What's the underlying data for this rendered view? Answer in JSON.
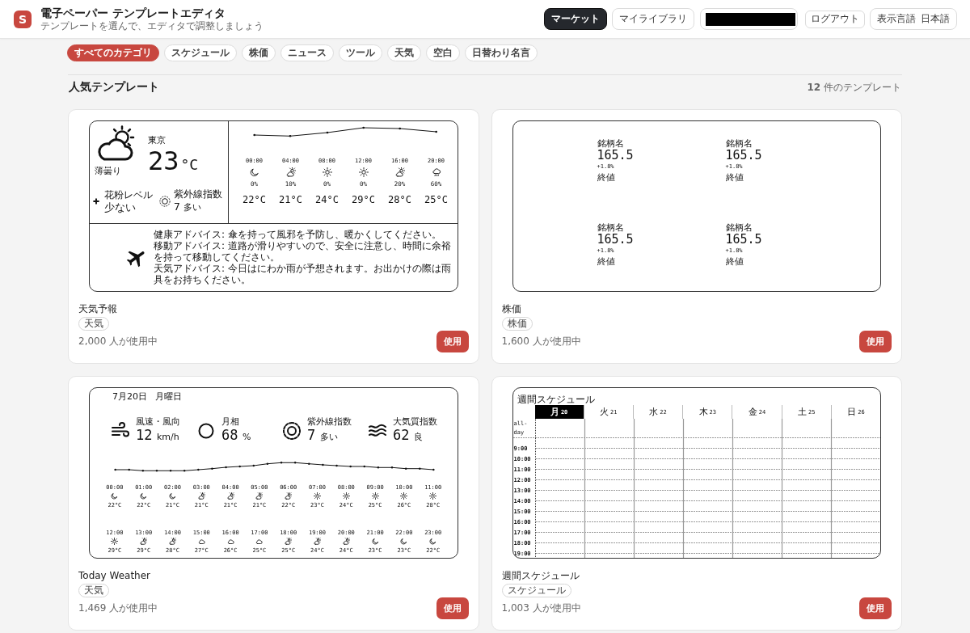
{
  "header": {
    "logo": "S",
    "title": "電子ペーパー テンプレートエディタ",
    "subtitle": "テンプレートを選んで、エディタで調整しましょう",
    "nav": [
      {
        "label": "マーケット",
        "selected": true
      },
      {
        "label": "マイライブラリ",
        "selected": false
      }
    ],
    "logout": "ログアウト",
    "language": {
      "label": "表示言語",
      "value": "日本語"
    }
  },
  "categories": [
    {
      "label": "すべてのカテゴリ",
      "selected": true
    },
    {
      "label": "スケジュール",
      "selected": false
    },
    {
      "label": "株価",
      "selected": false
    },
    {
      "label": "ニュース",
      "selected": false
    },
    {
      "label": "ツール",
      "selected": false
    },
    {
      "label": "天気",
      "selected": false
    },
    {
      "label": "空白",
      "selected": false
    },
    {
      "label": "日替わり名言",
      "selected": false
    }
  ],
  "section": {
    "title": "人気テンプレート",
    "count": "**12** 件のテンプレート"
  },
  "templates": [
    {
      "kind": "weather_forecast",
      "name": "天気予報",
      "tag": "天気",
      "usage": "2,000 人が使用中",
      "action": "使用",
      "preview": {
        "city": "東京",
        "temperature": "23",
        "unit": "°C",
        "condition": "薄曇り",
        "pollen": {
          "label": "花粉レベル",
          "value": "少ない"
        },
        "uv": {
          "label": "紫外線指数",
          "value": "7",
          "note": "多い"
        },
        "hours": [
          {
            "time": "00:00",
            "kind": "moon",
            "precip": "0%",
            "temp": "22°C"
          },
          {
            "time": "04:00",
            "kind": "cloud_sun",
            "precip": "10%",
            "temp": "21°C"
          },
          {
            "time": "08:00",
            "kind": "sun",
            "precip": "0%",
            "temp": "24°C"
          },
          {
            "time": "12:00",
            "kind": "sun",
            "precip": "0%",
            "temp": "29°C"
          },
          {
            "time": "16:00",
            "kind": "cloud_sun",
            "precip": "20%",
            "temp": "28°C"
          },
          {
            "time": "20:00",
            "kind": "rain",
            "precip": "60%",
            "temp": "25°C"
          }
        ],
        "advice": [
          "健康アドバイス: 傘を持って風邪を予防し、暖かくしてください。",
          "移動アドバイス: 道路が滑りやすいので、安全に注意し、時間に余裕を持って移動してください。",
          "天気アドバイス: 今日はにわか雨が予想されます。お出かけの際は雨具をお持ちください。"
        ]
      }
    },
    {
      "kind": "stocks",
      "name": "株価",
      "tag": "株価",
      "usage": "1,600 人が使用中",
      "action": "使用",
      "preview": {
        "stocks": [
          {
            "name": "銘柄名",
            "price": "165.5",
            "change": "+1.8%",
            "note": "終値"
          },
          {
            "name": "銘柄名",
            "price": "165.5",
            "change": "+1.8%",
            "note": "終値"
          },
          {
            "name": "銘柄名",
            "price": "165.5",
            "change": "+1.8%",
            "note": "終値"
          },
          {
            "name": "銘柄名",
            "price": "165.5",
            "change": "+1.8%",
            "note": "終値"
          }
        ]
      }
    },
    {
      "kind": "today_weather",
      "name": "Today Weather",
      "tag": "天気",
      "usage": "1,469 人が使用中",
      "action": "使用",
      "preview": {
        "date": "7月20日",
        "weekday": "月曜日",
        "metrics": [
          {
            "kind": "wind",
            "label": "風速・風向",
            "value": "12",
            "unit": "km/h"
          },
          {
            "kind": "moon_phase",
            "label": "月相",
            "value": "68",
            "unit": "%"
          },
          {
            "kind": "uv",
            "label": "紫外線指数",
            "value": "7",
            "unit": "多い"
          },
          {
            "kind": "air",
            "label": "大気質指数",
            "value": "62",
            "unit": "良"
          }
        ],
        "hour_rows": [
          [
            {
              "time": "00:00",
              "kind": "moon",
              "temp": "22°C"
            },
            {
              "time": "01:00",
              "kind": "moon",
              "temp": "22°C"
            },
            {
              "time": "02:00",
              "kind": "moon",
              "temp": "21°C"
            },
            {
              "time": "03:00",
              "kind": "cloud_sun",
              "temp": "21°C"
            },
            {
              "time": "04:00",
              "kind": "cloud_sun",
              "temp": "21°C"
            },
            {
              "time": "05:00",
              "kind": "cloud_sun",
              "temp": "21°C"
            },
            {
              "time": "06:00",
              "kind": "cloud_sun",
              "temp": "22°C"
            },
            {
              "time": "07:00",
              "kind": "sun",
              "temp": "23°C"
            },
            {
              "time": "08:00",
              "kind": "sun",
              "temp": "24°C"
            },
            {
              "time": "09:00",
              "kind": "sun",
              "temp": "25°C"
            },
            {
              "time": "10:00",
              "kind": "sun",
              "temp": "26°C"
            },
            {
              "time": "11:00",
              "kind": "sun",
              "temp": "28°C"
            }
          ],
          [
            {
              "time": "12:00",
              "kind": "sun",
              "temp": "29°C"
            },
            {
              "time": "13:00",
              "kind": "cloud_sun",
              "temp": "29°C"
            },
            {
              "time": "14:00",
              "kind": "cloud_sun",
              "temp": "28°C"
            },
            {
              "time": "15:00",
              "kind": "cloud",
              "temp": "27°C"
            },
            {
              "time": "16:00",
              "kind": "cloud",
              "temp": "26°C"
            },
            {
              "time": "17:00",
              "kind": "cloud",
              "temp": "25°C"
            },
            {
              "time": "18:00",
              "kind": "cloud_sun",
              "temp": "25°C"
            },
            {
              "time": "19:00",
              "kind": "cloud_sun",
              "temp": "24°C"
            },
            {
              "time": "20:00",
              "kind": "cloud_sun",
              "temp": "24°C"
            },
            {
              "time": "21:00",
              "kind": "moon",
              "temp": "23°C"
            },
            {
              "time": "22:00",
              "kind": "moon",
              "temp": "23°C"
            },
            {
              "time": "23:00",
              "kind": "moon",
              "temp": "22°C"
            }
          ]
        ]
      }
    },
    {
      "kind": "weekly_schedule",
      "name": "週間スケジュール",
      "tag": "スケジュール",
      "usage": "1,003 人が使用中",
      "action": "使用",
      "preview": {
        "title": "週間スケジュール",
        "days": [
          {
            "day": "月",
            "date": "20",
            "selected": true
          },
          {
            "day": "火",
            "date": "21",
            "selected": false
          },
          {
            "day": "水",
            "date": "22",
            "selected": false
          },
          {
            "day": "木",
            "date": "23",
            "selected": false
          },
          {
            "day": "金",
            "date": "24",
            "selected": false
          },
          {
            "day": "土",
            "date": "25",
            "selected": false
          },
          {
            "day": "日",
            "date": "26",
            "selected": false
          }
        ],
        "all_day_label": "all-day",
        "times": [
          "9:00",
          "10:00",
          "11:00",
          "12:00",
          "13:00",
          "14:00",
          "15:00",
          "16:00",
          "17:00",
          "18:00",
          "19:00"
        ]
      }
    }
  ]
}
